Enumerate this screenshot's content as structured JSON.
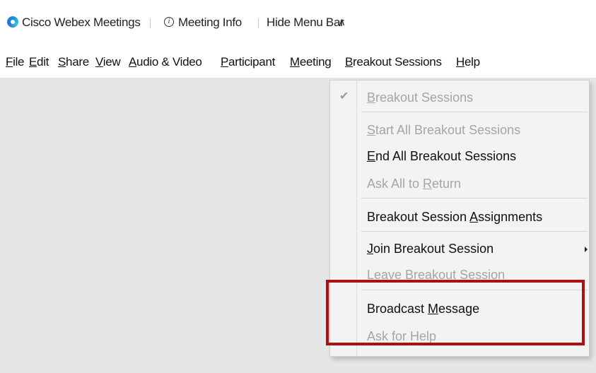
{
  "titlebar": {
    "app_name": "Cisco Webex Meetings",
    "meeting_info": "Meeting Info",
    "hide_menu_bar": "Hide Menu Bar"
  },
  "menubar": {
    "items": [
      {
        "pre": "",
        "u": "F",
        "post": "ile"
      },
      {
        "pre": "",
        "u": "E",
        "post": "dit"
      },
      {
        "pre": "",
        "u": "S",
        "post": "hare"
      },
      {
        "pre": "",
        "u": "V",
        "post": "iew"
      },
      {
        "pre": "",
        "u": "A",
        "post": "udio & Video"
      },
      {
        "pre": "",
        "u": "P",
        "post": "articipant"
      },
      {
        "pre": "",
        "u": "M",
        "post": "eeting"
      },
      {
        "pre": "",
        "u": "B",
        "post": "reakout Sessions"
      },
      {
        "pre": "",
        "u": "H",
        "post": "elp"
      }
    ]
  },
  "dropdown": {
    "items": [
      {
        "pre": "",
        "u": "B",
        "post": "reakout Sessions",
        "enabled": false,
        "checked": true
      },
      {
        "pre": "",
        "u": "S",
        "post": "tart All Breakout Sessions",
        "enabled": false
      },
      {
        "pre": "",
        "u": "E",
        "post": "nd All Breakout Sessions",
        "enabled": true
      },
      {
        "pre": "Ask All to ",
        "u": "R",
        "post": "eturn",
        "enabled": false
      },
      {
        "pre": "Breakout Session ",
        "u": "A",
        "post": "ssignments",
        "enabled": true
      },
      {
        "pre": "",
        "u": "J",
        "post": "oin Breakout Session",
        "enabled": true,
        "submenu": true
      },
      {
        "pre": "",
        "u": "L",
        "post": "eave Breakout Session",
        "enabled": false
      },
      {
        "pre": "Broadcast ",
        "u": "M",
        "post": "essage",
        "enabled": true
      },
      {
        "pre": "Ask for Help",
        "u": "",
        "post": "",
        "enabled": false
      }
    ]
  },
  "colors": {
    "highlight_border": "#b00f12",
    "content_bg": "#e6e6e6",
    "menu_bg": "#f3f3f3",
    "disabled_text": "#a5a5a5"
  },
  "icons": [
    "webex-logo-icon",
    "info-icon",
    "chevron-up-icon",
    "checkmark-icon",
    "submenu-arrow-icon"
  ]
}
